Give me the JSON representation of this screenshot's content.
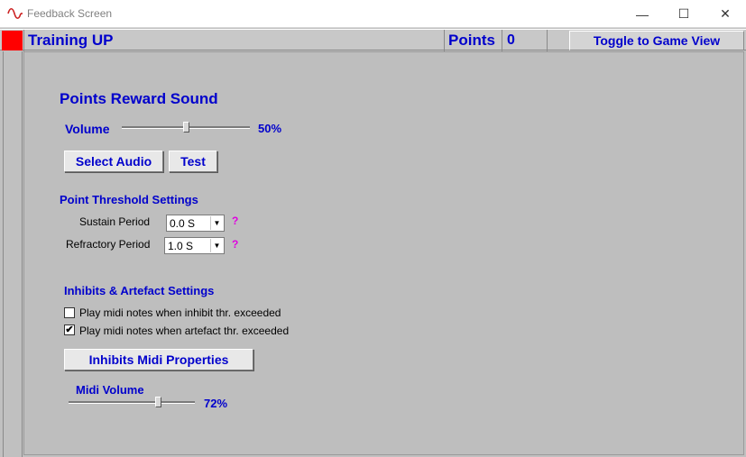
{
  "window": {
    "title": "Feedback Screen",
    "minimize_glyph": "—",
    "maximize_glyph": "☐",
    "close_glyph": "✕"
  },
  "header": {
    "mode_title": "Training UP",
    "points_label": "Points",
    "points_value": "0",
    "toggle_label": "Toggle to Game View",
    "accent_color": "#ff0000"
  },
  "reward_sound": {
    "title": "Points Reward Sound",
    "volume_label": "Volume",
    "volume_value": "50%",
    "volume_level": 0.5,
    "select_audio_label": "Select Audio",
    "test_label": "Test"
  },
  "threshold": {
    "title": "Point Threshold Settings",
    "sustain_label": "Sustain Period",
    "sustain_value": "0.0 S",
    "refractory_label": "Refractory Period",
    "refractory_value": "1.0 S",
    "help_glyph": "?"
  },
  "inhibits": {
    "title": "Inhibits & Artefact Settings",
    "inhibit_label": "Play midi notes when inhibit thr. exceeded",
    "inhibit_checked": false,
    "artefact_label": "Play midi notes when artefact thr. exceeded",
    "artefact_checked": true,
    "midi_props_label": "Inhibits Midi Properties",
    "midi_volume_label": "Midi Volume",
    "midi_volume_value": "72%",
    "midi_volume_level": 0.72
  }
}
